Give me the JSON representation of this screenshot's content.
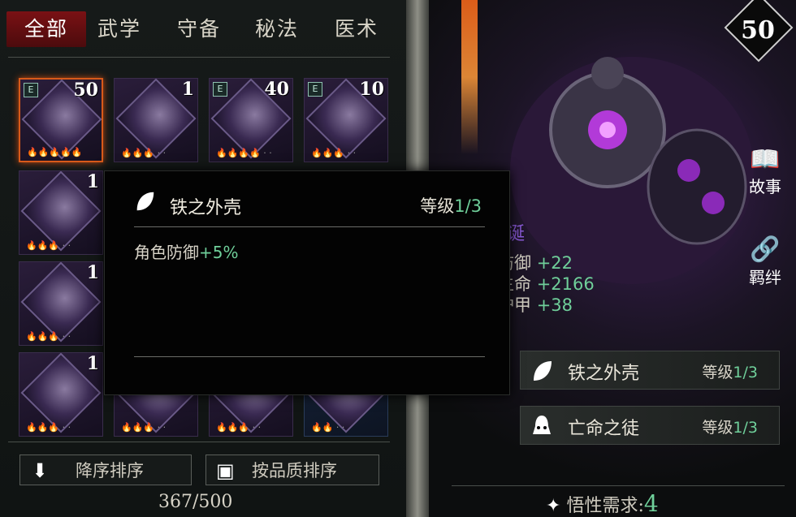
{
  "tabs": [
    "全部",
    "武学",
    "守备",
    "秘法",
    "医术"
  ],
  "cards": [
    {
      "level": "50",
      "e": true,
      "flames": "🔥🔥🔥🔥🔥",
      "dots": "",
      "selected": true
    },
    {
      "level": "1",
      "e": false,
      "flames": "🔥🔥🔥",
      "dots": "· ·",
      "selected": false
    },
    {
      "level": "40",
      "e": true,
      "flames": "🔥🔥🔥🔥",
      "dots": "· ·",
      "selected": false
    },
    {
      "level": "10",
      "e": true,
      "flames": "🔥🔥🔥",
      "dots": "· ·",
      "selected": false
    },
    {
      "level": "1",
      "e": false,
      "flames": "🔥🔥🔥",
      "dots": "· ·",
      "selected": false
    },
    {
      "level": "1",
      "e": false,
      "flames": "🔥🔥🔥",
      "dots": "· ·",
      "selected": false
    },
    {
      "level": "1",
      "e": false,
      "flames": "🔥🔥🔥",
      "dots": "· ·",
      "selected": false
    },
    {
      "level": "",
      "e": false,
      "flames": "🔥🔥🔥",
      "dots": "· ·",
      "selected": false
    },
    {
      "level": "",
      "e": false,
      "flames": "🔥🔥🔥",
      "dots": "· ·",
      "selected": false
    },
    {
      "level": "",
      "e": false,
      "flames": "🔥🔥",
      "dots": "· ·",
      "selected": false
    }
  ],
  "sort": {
    "descending": "降序排序",
    "by_quality": "按品质排序"
  },
  "count": "367/500",
  "hero": {
    "level": "50",
    "name_partial": "诞",
    "side": {
      "story": "故事",
      "bond": "羁绊"
    },
    "stats": [
      {
        "name": "防御",
        "value": "+22"
      },
      {
        "name": "生命",
        "value": "+2166"
      },
      {
        "name": "护甲",
        "value": "+38"
      }
    ],
    "skills": [
      {
        "name": "铁之外壳",
        "level_label": "等级",
        "level": "1/3"
      },
      {
        "name": "亡命之徒",
        "level_label": "等级",
        "level": "1/3"
      }
    ],
    "requirement_label": "悟性需求:",
    "requirement_value": "4"
  },
  "tooltip": {
    "title": "铁之外壳",
    "level_label": "等级",
    "level": "1/3",
    "desc_label": "角色防御",
    "desc_value": "+5%"
  },
  "colors": {
    "accent_green": "#6fcf9a",
    "tab_active": "#7a1114",
    "selected_border": "#d85a1a"
  },
  "icons": [
    "leaf-icon",
    "bell-icon",
    "book-icon",
    "chain-link-icon",
    "arrow-down-icon",
    "cube-icon",
    "sparkle-icon",
    "e-badge-icon"
  ]
}
